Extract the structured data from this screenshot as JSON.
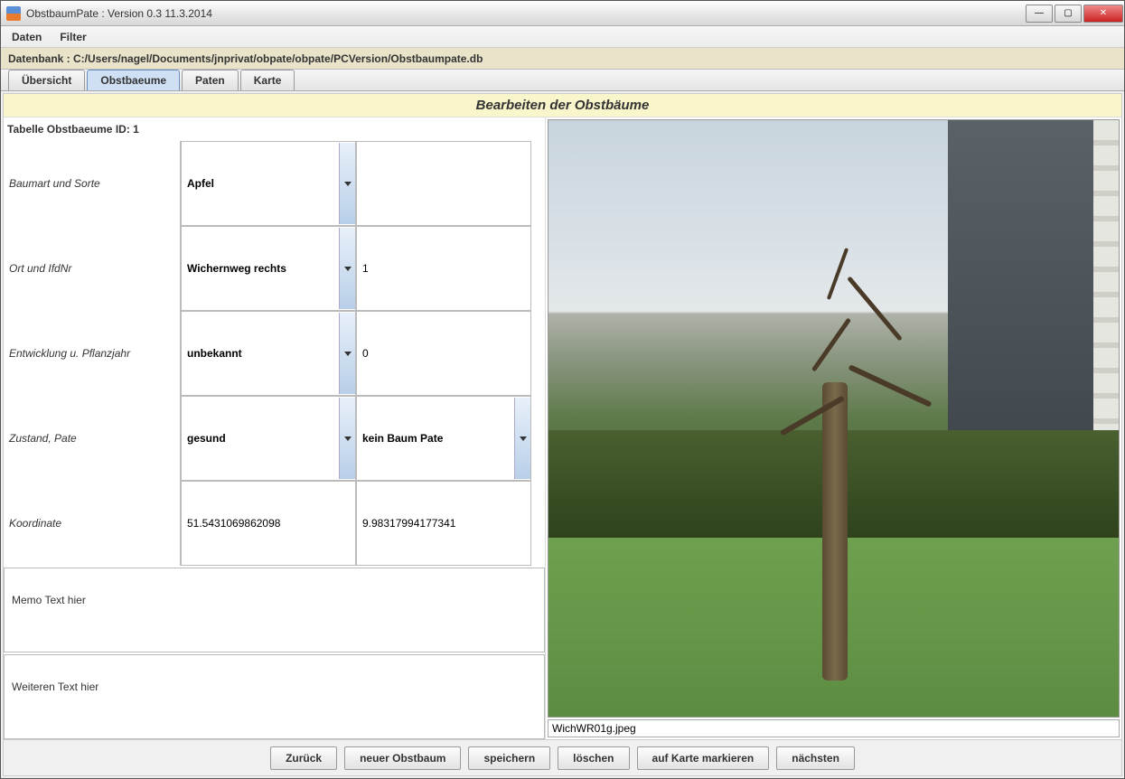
{
  "window": {
    "title": "ObstbaumPate : Version 0.3 11.3.2014"
  },
  "menubar": {
    "items": [
      "Daten",
      "Filter"
    ]
  },
  "dbbar": {
    "text": "Datenbank : C:/Users/nagel/Documents/jnprivat/obpate/obpate/PCVersion/Obstbaumpate.db"
  },
  "tabs": {
    "items": [
      "Übersicht",
      "Obstbaeume",
      "Paten",
      "Karte"
    ],
    "active_index": 1
  },
  "section_title": "Bearbeiten der Obstbäume",
  "table_label": "Tabelle Obstbaeume ID: 1",
  "form": {
    "rows": [
      {
        "label": "Baumart und Sorte",
        "col2": "Apfel",
        "col2_dropdown": true,
        "col3": "",
        "col3_dropdown": false
      },
      {
        "label": "Ort und IfdNr",
        "col2": "Wichernweg rechts",
        "col2_dropdown": true,
        "col3": "1",
        "col3_dropdown": false
      },
      {
        "label": "Entwicklung u. Pflanzjahr",
        "col2": "unbekannt",
        "col2_dropdown": true,
        "col3": "0",
        "col3_dropdown": false
      },
      {
        "label": "Zustand, Pate",
        "col2": "gesund",
        "col2_dropdown": true,
        "col3": "kein Baum Pate",
        "col3_dropdown": true
      },
      {
        "label": "Koordinate",
        "col2": "51.5431069862098",
        "col2_dropdown": false,
        "col3": "9.98317994177341",
        "col3_dropdown": false
      }
    ]
  },
  "memo1": "Memo Text hier",
  "memo2": "Weiteren Text hier",
  "image_caption": "WichWR01g.jpeg",
  "buttons": {
    "back": "Zurück",
    "new": "neuer Obstbaum",
    "save": "speichern",
    "delete": "löschen",
    "mark_on_map": "auf Karte markieren",
    "next": "nächsten"
  }
}
